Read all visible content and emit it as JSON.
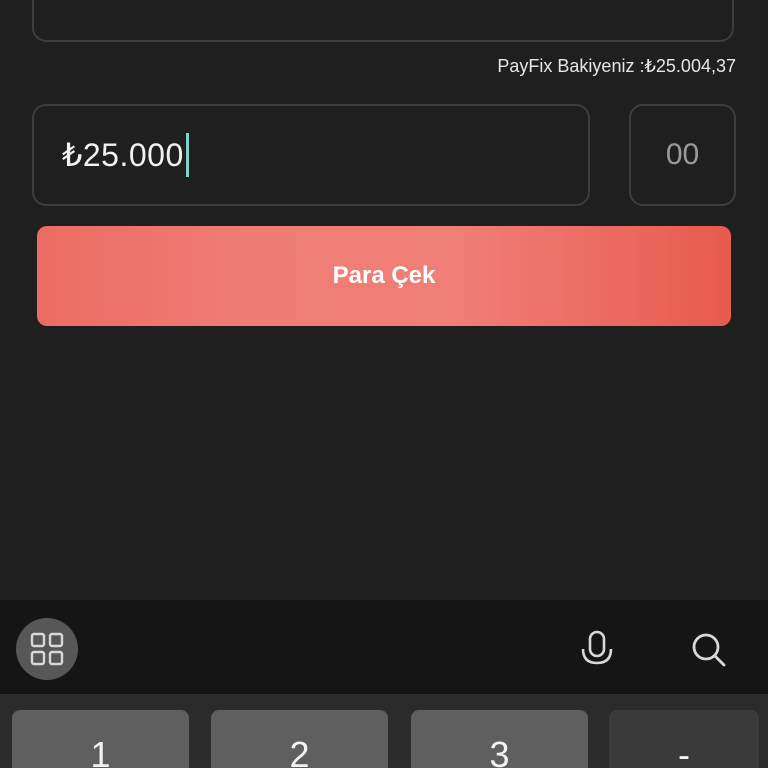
{
  "balance": {
    "label": "PayFix Bakiyeniz :₺25.004,37"
  },
  "amount_input": {
    "value": "₺25.000"
  },
  "decimal_input": {
    "value": "00"
  },
  "withdraw_button": {
    "label": "Para Çek"
  },
  "colors": {
    "background": "#1f1f1f",
    "button_gradient_start": "#ec6c62",
    "button_gradient_end": "#e85b4d",
    "caret": "#7fd3cc"
  },
  "keyboard": {
    "toolbar_icons": [
      "apps-grid-icon",
      "microphone-icon",
      "search-icon"
    ],
    "keys": [
      "1",
      "2",
      "3",
      "-"
    ]
  }
}
